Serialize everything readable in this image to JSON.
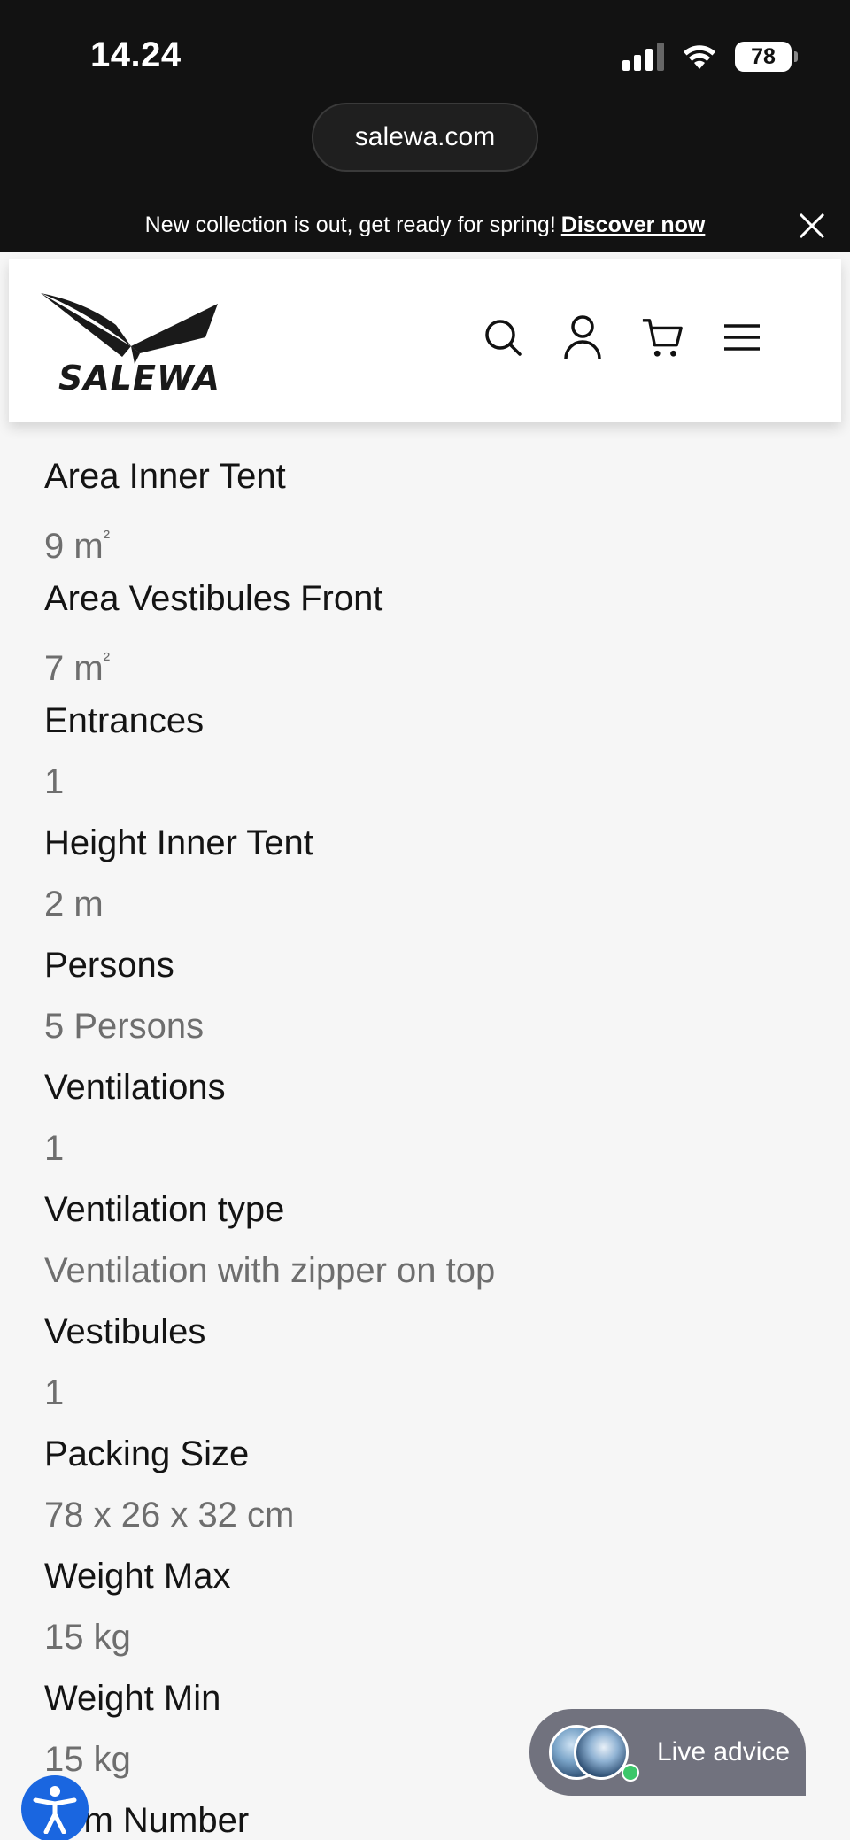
{
  "status_bar": {
    "time": "14.24",
    "battery": "78",
    "url": "salewa.com"
  },
  "promo_banner": {
    "text": "New collection is out, get ready for spring!",
    "link": "Discover now"
  },
  "header": {
    "logo_text": "SALEWA",
    "icons": [
      "search-icon",
      "user-account-icon",
      "cart-icon",
      "menu-icon"
    ]
  },
  "specs": [
    {
      "label": "Area Inner Tent",
      "value": "9 m",
      "sup": "²"
    },
    {
      "label": "Area Vestibules Front",
      "value": "7 m",
      "sup": "²"
    },
    {
      "label": "Entrances",
      "value": "1"
    },
    {
      "label": "Height Inner Tent",
      "value": "2 m"
    },
    {
      "label": "Persons",
      "value": "5 Persons"
    },
    {
      "label": "Ventilations",
      "value": "1"
    },
    {
      "label": "Ventilation type",
      "value": "Ventilation with zipper on top"
    },
    {
      "label": "Vestibules",
      "value": "1"
    },
    {
      "label": "Packing Size",
      "value": "78 x 26 x 32 cm"
    },
    {
      "label": "Weight Max",
      "value": "15 kg"
    },
    {
      "label": "Weight Min",
      "value": "15 kg"
    },
    {
      "label": "Item Number",
      "value": ""
    }
  ],
  "live_advice": {
    "label": "Live advice",
    "status_color": "#3cc76a"
  },
  "colors": {
    "accessibility_button": "#1a66e0",
    "live_advice_bg": "#71727e"
  }
}
